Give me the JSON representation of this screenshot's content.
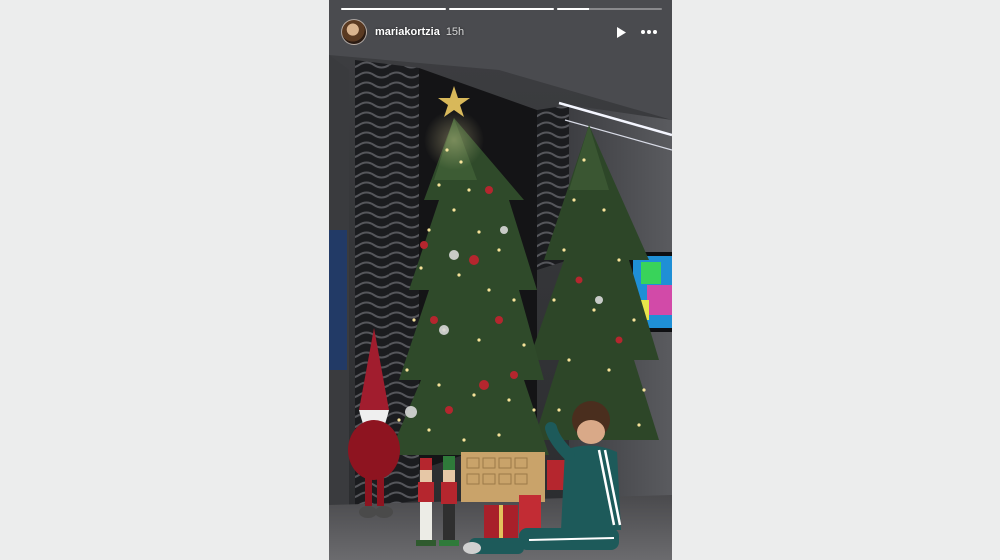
{
  "story": {
    "username": "mariakortzia",
    "timestamp": "15h",
    "progress": {
      "segments": 3,
      "current_segment": 3,
      "current_fraction": 0.3
    },
    "controls": {
      "play_icon": "play-icon",
      "more_icon": "more-options-icon"
    },
    "avatar_icon": "avatar"
  },
  "colors": {
    "page_background": "#eceded",
    "story_background": "#2a2a2c",
    "tree_green": "#2f4a2a",
    "ornament_red": "#b5262e",
    "light_gold": "#f2d98a",
    "tracksuit_green": "#1d5a5a"
  }
}
